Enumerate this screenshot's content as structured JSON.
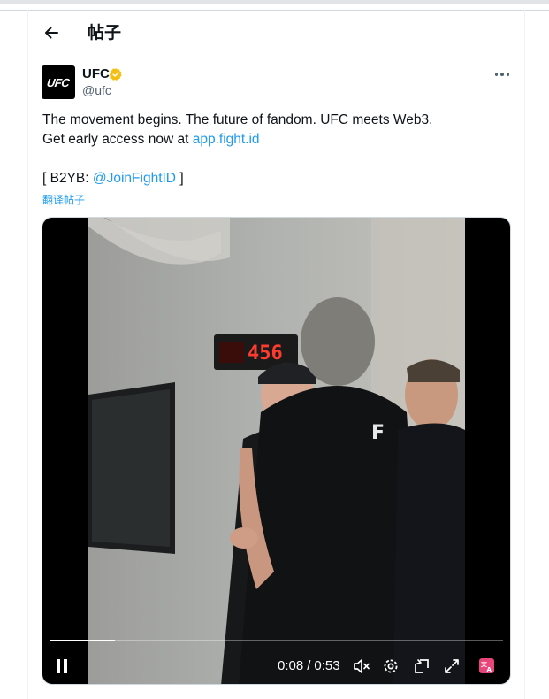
{
  "header": {
    "title": "帖子"
  },
  "tweet": {
    "author_name": "UFC",
    "author_handle": "@ufc",
    "avatar_text": "UFC",
    "line1": "The movement begins. The future of fandom. UFC meets Web3.",
    "line2_prefix": "Get early access now at ",
    "line2_link": "app.fight.id",
    "line3_prefix": "[ B2YB: ",
    "line3_link": "@JoinFightID",
    "line3_suffix": " ]",
    "translate_label": "翻译帖子"
  },
  "video": {
    "current_time": "0:08",
    "duration": "0:53",
    "progress": 0.145,
    "scoreboard_digits": "456"
  },
  "colors": {
    "link": "#1d9bf0",
    "verified": "#f3c011",
    "translate_icon_bg": "#e8457a"
  }
}
